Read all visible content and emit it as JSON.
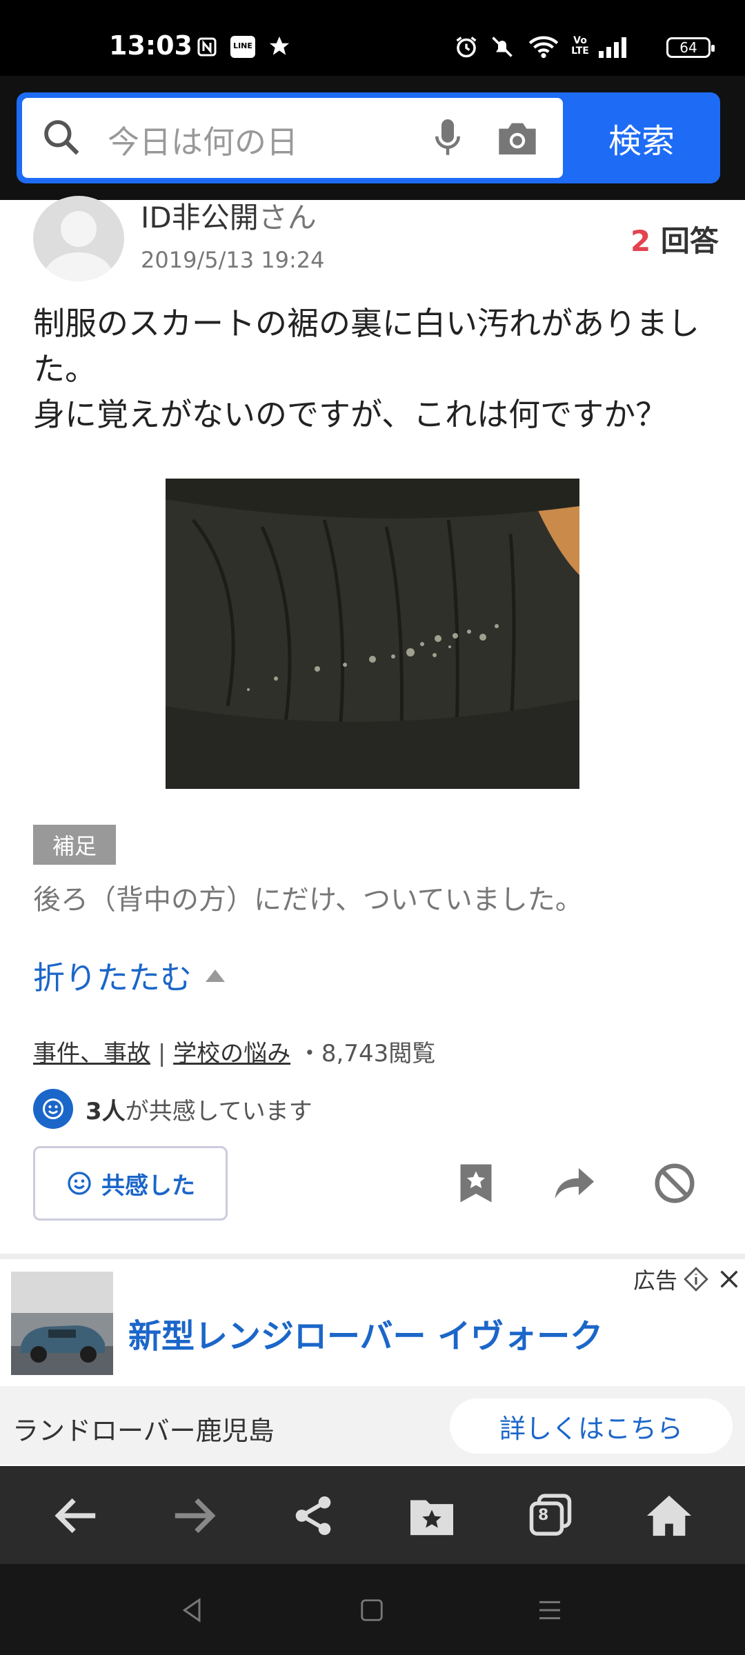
{
  "status_bar": {
    "time": "13:03",
    "icons": [
      "nfc-icon",
      "line-manga-icon",
      "star-icon",
      "alarm-icon",
      "mute-icon",
      "wifi-icon",
      "volte-icon",
      "signal-icon"
    ],
    "line_label": "LINE",
    "volte_label": "Vo LTE",
    "battery": "64"
  },
  "search": {
    "placeholder": "今日は何の日",
    "button_label": "検索"
  },
  "question": {
    "author": "ID非公開",
    "author_suffix": "さん",
    "date": "2019/5/13 19:24",
    "answer_count": "2",
    "answer_label": "回答",
    "body_line1": "制服のスカートの裾の裏に白い汚れがありました。",
    "body_line2": "身に覚えがないのですが、これは何ですか？",
    "supplement_badge": "補足",
    "supplement_text": "後ろ（背中の方）にだけ、ついていました。",
    "fold_label": "折りたたむ",
    "category1": "事件、事故",
    "separator": "|",
    "category2": "学校の悩み",
    "views": "・8,743閲覧",
    "sympathy_count": "3人",
    "sympathy_text": "が共感しています",
    "sympathy_button": "共感した"
  },
  "ad": {
    "label": "広告",
    "title": "新型レンジローバー イヴォーク",
    "advertiser": "ランドローバー鹿児島",
    "cta": "詳しくはこちら"
  },
  "browser_bar": {
    "tab_count": "8"
  },
  "colors": {
    "accent_blue": "#1e6cf5",
    "link_blue": "#1b66c9",
    "answer_red": "#e2434f"
  }
}
